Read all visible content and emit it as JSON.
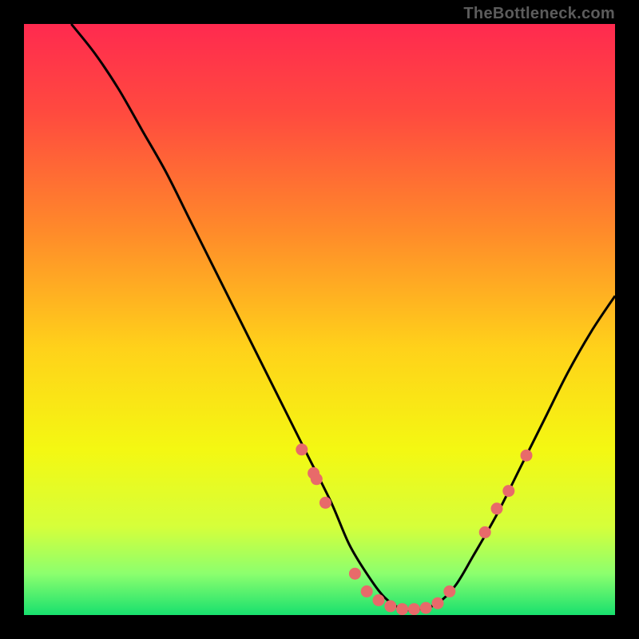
{
  "watermark": "TheBottleneck.com",
  "chart_data": {
    "type": "line",
    "title": "",
    "xlabel": "",
    "ylabel": "",
    "xlim": [
      0,
      100
    ],
    "ylim": [
      0,
      100
    ],
    "series": [
      {
        "name": "curve",
        "x": [
          8,
          12,
          16,
          20,
          24,
          28,
          32,
          36,
          40,
          44,
          48,
          52,
          55,
          58,
          61,
          64,
          67,
          70,
          73,
          76,
          80,
          84,
          88,
          92,
          96,
          100
        ],
        "y": [
          100,
          95,
          89,
          82,
          75,
          67,
          59,
          51,
          43,
          35,
          27,
          19,
          12,
          7,
          3,
          1,
          1,
          2,
          5,
          10,
          17,
          25,
          33,
          41,
          48,
          54
        ]
      }
    ],
    "markers": {
      "name": "highlight-points",
      "x": [
        47,
        49,
        49.5,
        51,
        56,
        58,
        60,
        62,
        64,
        66,
        68,
        70,
        72,
        78,
        80,
        82,
        85
      ],
      "y": [
        28,
        24,
        23,
        19,
        7,
        4,
        2.5,
        1.5,
        1,
        1,
        1.2,
        2,
        4,
        14,
        18,
        21,
        27
      ]
    },
    "gradient_stops": [
      {
        "offset": 0.0,
        "color": "#ff2a4f"
      },
      {
        "offset": 0.15,
        "color": "#ff4a3f"
      },
      {
        "offset": 0.35,
        "color": "#ff8a2a"
      },
      {
        "offset": 0.55,
        "color": "#ffd21a"
      },
      {
        "offset": 0.72,
        "color": "#f4f812"
      },
      {
        "offset": 0.85,
        "color": "#d6ff3a"
      },
      {
        "offset": 0.93,
        "color": "#8cff6e"
      },
      {
        "offset": 1.0,
        "color": "#18e06e"
      }
    ],
    "marker_color": "#e86a6a",
    "curve_color": "#000000"
  }
}
